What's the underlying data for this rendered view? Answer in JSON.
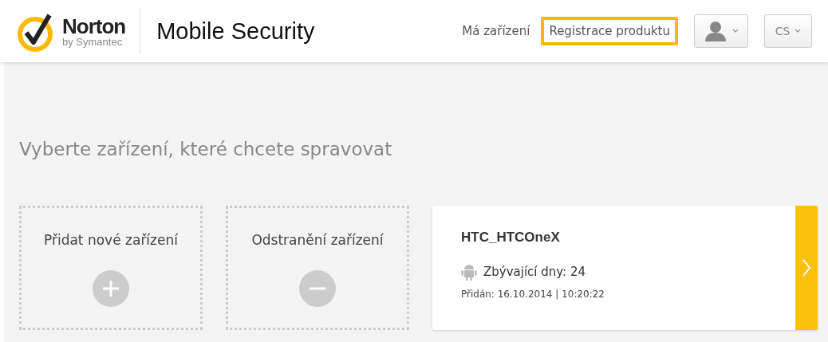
{
  "header": {
    "brand": {
      "name": "Norton",
      "tagline": "by Symantec"
    },
    "product": "Mobile Security",
    "nav": [
      {
        "label": "Má zařízení",
        "highlighted": false
      },
      {
        "label": "Registrace produktu",
        "highlighted": true
      }
    ],
    "language": "CS"
  },
  "heading": "Vyberte zařízení, které chcete spravovat",
  "actions": [
    {
      "kind": "add",
      "label": "Přidat nové zařízení"
    },
    {
      "kind": "remove",
      "label": "Odstranění zařízení"
    }
  ],
  "devices": [
    {
      "name": "HTC_HTCOneX",
      "days_left": "Zbývající dny: 24",
      "added": "Přidán: 16.10.2014 | 10:20:22"
    }
  ]
}
